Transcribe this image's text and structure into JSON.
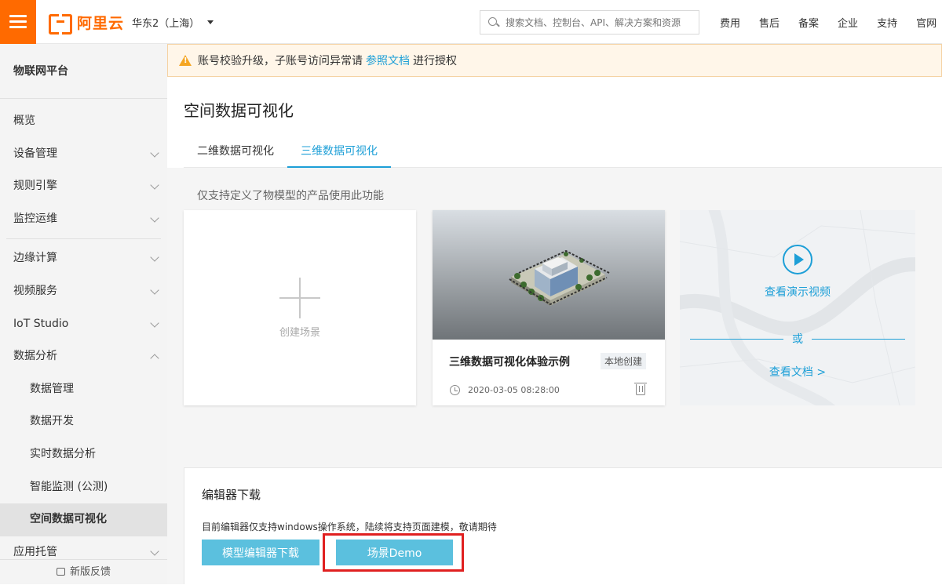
{
  "header": {
    "brand": "阿里云",
    "region": "华东2（上海）",
    "search_placeholder": "搜索文档、控制台、API、解决方案和资源",
    "nav": [
      "费用",
      "售后",
      "备案",
      "企业",
      "支持",
      "官网"
    ]
  },
  "sidebar": {
    "title": "物联网平台",
    "items": [
      {
        "label": "概览"
      },
      {
        "label": "设备管理"
      },
      {
        "label": "规则引擎"
      },
      {
        "label": "监控运维"
      },
      {
        "label": "边缘计算"
      },
      {
        "label": "视频服务"
      },
      {
        "label": "IoT Studio"
      },
      {
        "label": "数据分析"
      },
      {
        "label": "数据管理"
      },
      {
        "label": "数据开发"
      },
      {
        "label": "实时数据分析"
      },
      {
        "label": "智能监测 (公测)"
      },
      {
        "label": "空间数据可视化"
      },
      {
        "label": "应用托管"
      }
    ],
    "feedback": "新版反馈"
  },
  "notice": {
    "text_before": "账号校验升级，子账号访问异常请",
    "link": "参照文档",
    "text_after": "进行授权"
  },
  "page": {
    "title": "空间数据可视化",
    "tabs": [
      {
        "label": "二维数据可视化"
      },
      {
        "label": "三维数据可视化"
      }
    ],
    "active_tab": 1,
    "hint": "仅支持定义了物模型的产品使用此功能"
  },
  "cards": {
    "create_label": "创建场景",
    "demo": {
      "name": "三维数据可视化体验示例",
      "badge": "本地创建",
      "time": "2020-03-05 08:28:00"
    },
    "video": {
      "video_link": "查看演示视频",
      "or": "或",
      "doc_link": "查看文档 >"
    }
  },
  "download": {
    "title": "编辑器下载",
    "desc": "目前编辑器仅支持windows操作系统，陆续将支持页面建模，敬请期待",
    "btn_model": "模型编辑器下载",
    "btn_demo": "场景Demo"
  },
  "colors": {
    "brand": "#ff6a00",
    "accent": "#1d9fd7",
    "button": "#5bc0de",
    "highlight": "#e02020"
  }
}
